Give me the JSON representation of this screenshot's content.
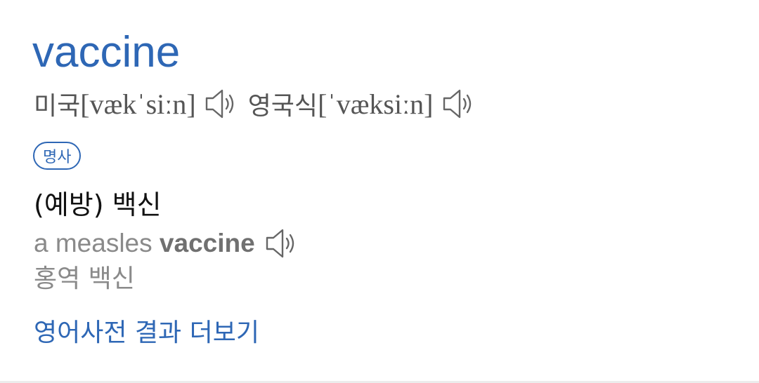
{
  "entry": {
    "headword": "vaccine",
    "pronunciations": [
      {
        "label": "미국",
        "ipa": "[vækˈsiːn]",
        "icon": "speaker-icon"
      },
      {
        "label": "영국식",
        "ipa": "[ˈvæksiːn]",
        "icon": "speaker-icon"
      }
    ],
    "part_of_speech": "명사",
    "meaning": "(예방) 백신",
    "example": {
      "prefix": "a measles ",
      "highlight": "vaccine",
      "icon": "speaker-icon",
      "translation": "홍역 백신"
    },
    "more_link": "영어사전 결과 더보기"
  },
  "colors": {
    "accent": "#2e67b5",
    "primary_text": "#111111",
    "secondary_text": "#555555",
    "muted_text": "#8a8a8a",
    "divider": "#ececec"
  }
}
